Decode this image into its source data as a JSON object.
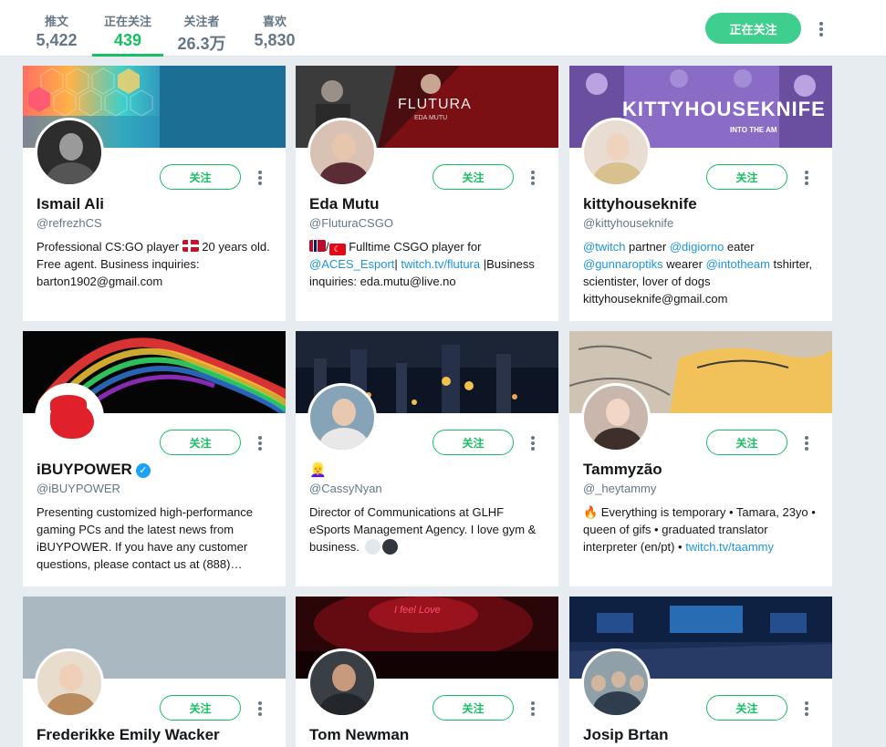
{
  "stats": [
    {
      "label": "推文",
      "value": "5,422"
    },
    {
      "label": "正在关注",
      "value": "439"
    },
    {
      "label": "关注者",
      "value": "26.3万"
    },
    {
      "label": "喜欢",
      "value": "5,830"
    }
  ],
  "header": {
    "following_button": "正在关注"
  },
  "colors": {
    "accent_green": "#17bf63",
    "link_blue": "#1b95e0",
    "page_bg": "#e6ecf0"
  },
  "cards": [
    {
      "name": "Ismail Ali",
      "handle": "@refrezhCS",
      "follow_label": "关注",
      "bio_1": "Professional CS:GO player ",
      "bio_2": " 20 years old. Free agent. Business inquiries: barton1902@gmail.com"
    },
    {
      "name": "Eda Mutu",
      "handle": "@FluturaCSGO",
      "follow_label": "关注",
      "banner_title": "FLUTURA",
      "banner_sub": "EDA MUTU",
      "bio_sep": "/",
      "bio_1": " Fulltime CSGO player for ",
      "bio_link_1": "@ACES_Esport",
      "bio_pipe": "|",
      "bio_link_2": "twitch.tv/flutura",
      "bio_2": " |Business inquiries: eda.mutu@live.no"
    },
    {
      "name": "kittyhouseknife",
      "handle": "@kittyhouseknife",
      "follow_label": "关注",
      "banner_title": "KITTYHOUSEKNIFE",
      "banner_sub": "INTO THE AM",
      "bio_link_1": "@twitch",
      "bio_1": " partner ",
      "bio_link_2": "@digiorno",
      "bio_2": " eater ",
      "bio_link_3": "@gunnaroptiks",
      "bio_3": " wearer ",
      "bio_link_4": "@intotheam",
      "bio_4": " tshirter, scientister, lover of dogs kittyhouseknife@gmail.com"
    },
    {
      "name": "iBUYPOWER",
      "handle": "@iBUYPOWER",
      "follow_label": "关注",
      "verified": "✓",
      "bio_1": "Presenting customized high-performance gaming PCs and the latest news from iBUYPOWER. If you have any customer questions, please contact us at (888)…"
    },
    {
      "name": "",
      "name_emoji": "👱‍♀️",
      "handle": "@CassyNyan",
      "follow_label": "关注",
      "bio_1": "Director of Communications at GLHF eSports Management Agency. I love gym & business. "
    },
    {
      "name": "Tammyzão",
      "handle": "@_heytammy",
      "follow_label": "关注",
      "bio_icon": "🔥",
      "bio_1": " Everything is temporary • Tamara, 23yo • queen of gifs • graduated translator interpreter (en/pt) • ",
      "bio_link_1": "twitch.tv/taammy"
    },
    {
      "name": "Frederikke Emily Wacker",
      "handle": "",
      "follow_label": "关注"
    },
    {
      "name": "Tom Newman",
      "handle": "",
      "follow_label": "关注",
      "banner_title": "I feel Love"
    },
    {
      "name": "Josip Brtan",
      "handle": "",
      "follow_label": "关注"
    }
  ]
}
